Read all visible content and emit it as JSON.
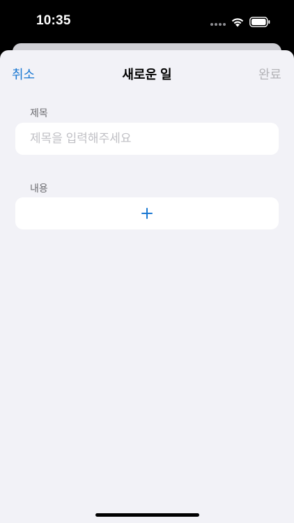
{
  "status_bar": {
    "time": "10:35",
    "icons": [
      "signal-dots-icon",
      "wifi-icon",
      "battery-icon"
    ]
  },
  "nav": {
    "cancel_label": "취소",
    "title": "새로운 일",
    "done_label": "완료"
  },
  "form": {
    "title_section_label": "제목",
    "title_value": "",
    "title_placeholder": "제목을 입력해주세요",
    "content_section_label": "내용",
    "add_content_icon": "plus-icon"
  },
  "colors": {
    "accent": "#1877d2",
    "disabled": "#b4b4b8",
    "sheet_background": "#f2f2f7",
    "card_background": "#ffffff"
  }
}
